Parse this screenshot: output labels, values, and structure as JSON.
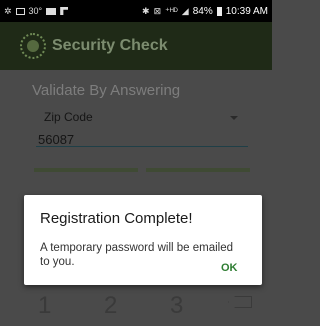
{
  "status_bar": {
    "signal_text": "⁺ᴴᴰ",
    "battery_percent": "84%",
    "time": "10:39 AM",
    "left_temp": "30°"
  },
  "app_bar": {
    "title": "Security Check"
  },
  "form": {
    "prompt": "Validate By Answering",
    "question_selected": "Zip Code",
    "answer_value": "56087"
  },
  "keypad": {
    "keys": [
      "1",
      "2",
      "3"
    ]
  },
  "dialog": {
    "title": "Registration Complete!",
    "message": "A temporary password will be emailed to you.",
    "ok_label": "OK"
  }
}
